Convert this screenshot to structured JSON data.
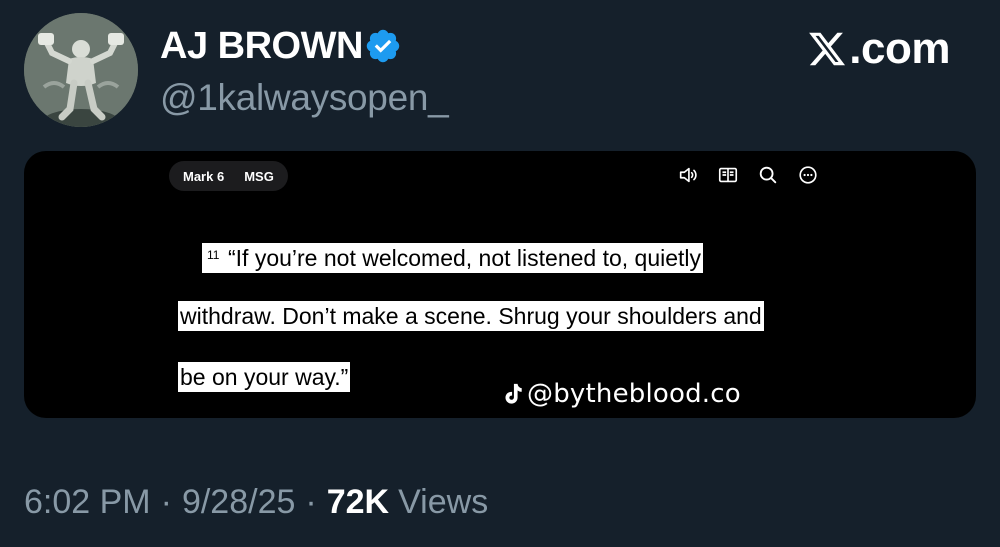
{
  "author": {
    "name": "AJ BROWN",
    "handle": "@1kalwaysopen_",
    "verified": true,
    "verified_color": "#1d9bf0",
    "avatar_icon": "statue-avatar"
  },
  "brand": {
    "logo_icon": "x-logo-icon",
    "suffix": ".com"
  },
  "media": {
    "reference": {
      "book": "Mark 6",
      "version": "MSG"
    },
    "toolbar_icons": [
      "speaker-icon",
      "book-icon",
      "search-icon",
      "more-icon"
    ],
    "verse_number": "11",
    "quote_lines": [
      "“If you’re not welcomed, not listened to, quietly",
      "withdraw. Don’t make a scene. Shrug your shoulders and",
      "be on your way.”"
    ],
    "watermark": "@bytheblood.co",
    "watermark_icon": "tiktok-icon"
  },
  "meta": {
    "time": "6:02 PM",
    "date": "9/28/25",
    "views_count": "72K",
    "views_label": "Views"
  }
}
